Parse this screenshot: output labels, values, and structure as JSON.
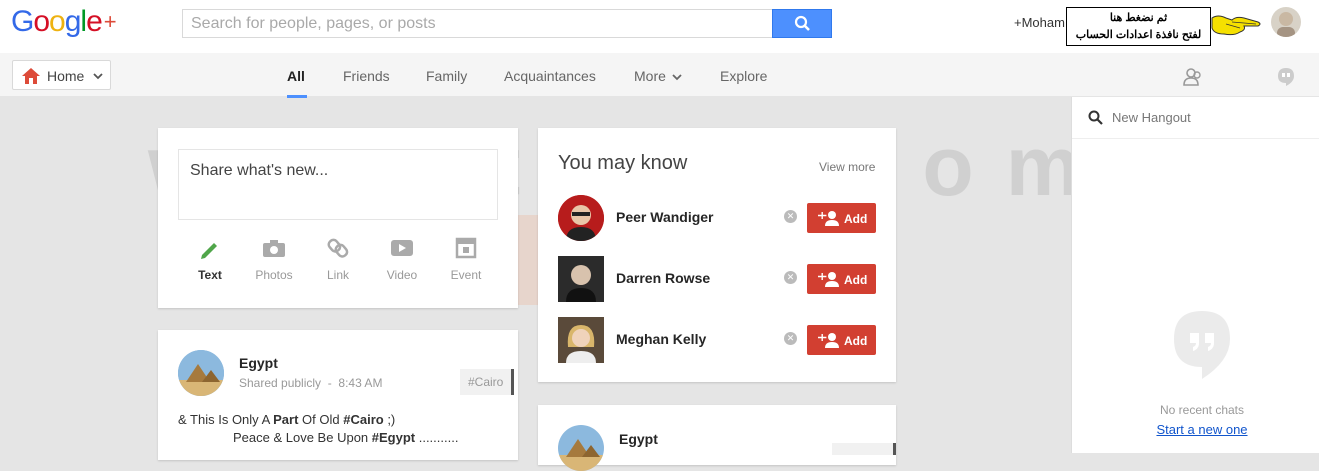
{
  "header": {
    "logo_text": "Google",
    "logo_plus": "+",
    "search_placeholder": "Search for people, pages, or posts",
    "username": "+Moham",
    "arabic_line1": "ثم نضغط هنا",
    "arabic_line2": "لفتح نافذة اعدادات الحساب"
  },
  "subnav": {
    "home_label": "Home",
    "tabs": [
      "All",
      "Friends",
      "Family",
      "Acquaintances",
      "More",
      "Explore"
    ],
    "active_tab": "All"
  },
  "share": {
    "placeholder": "Share what's new...",
    "items": [
      "Text",
      "Photos",
      "Link",
      "Video",
      "Event"
    ]
  },
  "you_may_know": {
    "title": "You may know",
    "view_more": "View more",
    "add_label": "Add",
    "people": [
      {
        "name": "Peer Wandiger"
      },
      {
        "name": "Darren Rowse"
      },
      {
        "name": "Meghan Kelly"
      }
    ]
  },
  "post1": {
    "author": "Egypt",
    "visibility": "Shared publicly",
    "separator": "-",
    "time": "8:43 AM",
    "hashtag": "#Cairo",
    "line1_a": "& This Is Only A ",
    "line1_b": "Part",
    "line1_c": " Of Old ",
    "line1_d": "#Cairo",
    "line1_e": " ;)",
    "line2_a": "Peace & Love Be Upon ",
    "line2_b": "#Egypt",
    "line2_c": " ..........."
  },
  "post2": {
    "author": "Egypt"
  },
  "hangouts": {
    "search_placeholder": "New Hangout",
    "empty_text": "No recent chats",
    "start_link": "Start a new one"
  },
  "watermark": "www.ts3a.com",
  "colors": {
    "accent_blue": "#4d90fe",
    "add_red": "#d23f31",
    "google_blue": "#3369e8",
    "google_red": "#d50f25",
    "google_yellow": "#eeb211",
    "google_green": "#009925"
  }
}
